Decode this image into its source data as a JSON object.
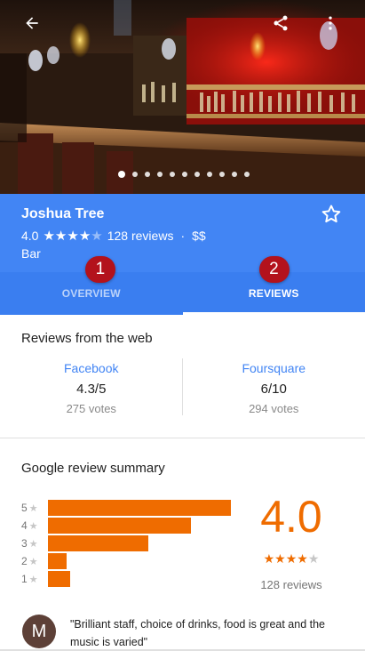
{
  "hero": {
    "photo_subject": "bar interior photo",
    "icons": {
      "back": "arrow-back-icon",
      "share": "share-icon",
      "more": "more-vert-icon"
    },
    "photo_count": 11,
    "active_photo_index": 0
  },
  "place": {
    "name": "Joshua Tree",
    "rating": "4.0",
    "stars_filled": 4,
    "stars_total": 5,
    "review_count": "128 reviews",
    "separator": "·",
    "price": "$$",
    "category": "Bar",
    "save_icon": "star-outline-icon"
  },
  "tabs": [
    {
      "label": "OVERVIEW",
      "badge": "1",
      "active": false
    },
    {
      "label": "REVIEWS",
      "badge": "2",
      "active": true
    }
  ],
  "web_reviews": {
    "title": "Reviews from the web",
    "sources": [
      {
        "name": "Facebook",
        "score": "4.3/5",
        "votes": "275 votes"
      },
      {
        "name": "Foursquare",
        "score": "6/10",
        "votes": "294 votes"
      }
    ]
  },
  "google_summary": {
    "title": "Google review summary",
    "score": "4.0",
    "stars_filled": 4,
    "review_count": "128 reviews",
    "distribution": [
      {
        "label": "5",
        "fraction": 1.0
      },
      {
        "label": "4",
        "fraction": 0.78
      },
      {
        "label": "3",
        "fraction": 0.55
      },
      {
        "label": "2",
        "fraction": 0.1
      },
      {
        "label": "1",
        "fraction": 0.12
      }
    ]
  },
  "snippet": {
    "avatar_letter": "M",
    "text": "\"Brilliant staff, choice of drinks, food is great and the music is varied\""
  },
  "colors": {
    "header_blue": "#4285f4",
    "tab_blue": "#3a7ef0",
    "accent_orange": "#ef6c00",
    "badge_red": "#b3121c",
    "link_blue": "#4285f4"
  }
}
